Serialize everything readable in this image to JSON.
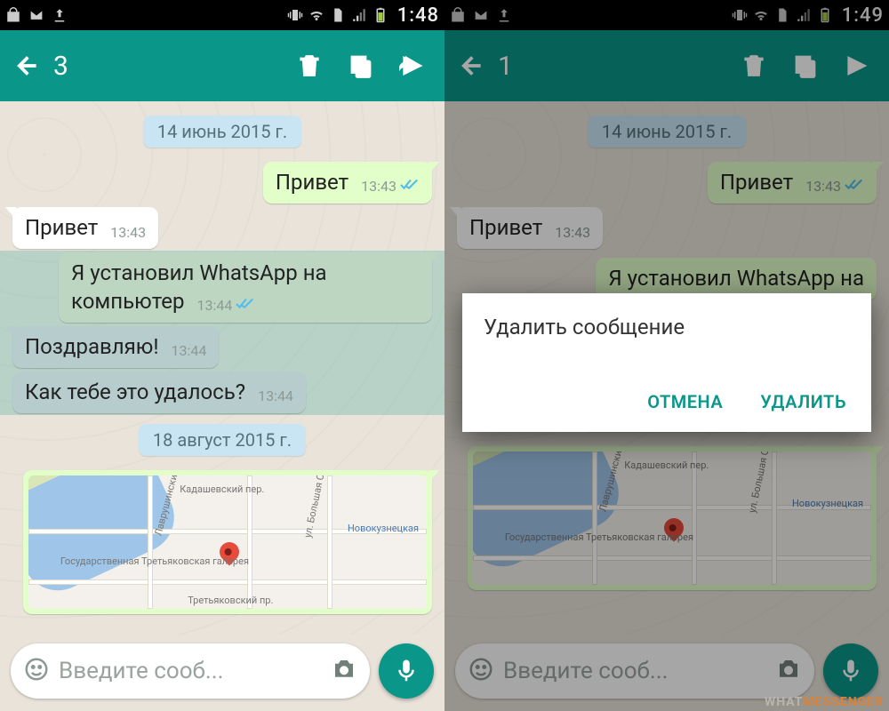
{
  "colors": {
    "teal": "#0a9688",
    "tick_read": "#53bdeb"
  },
  "left": {
    "status": {
      "clock": "1:48"
    },
    "selection_count": "3",
    "dates": {
      "d1": "14 июнь 2015 г.",
      "d2": "18 август 2015 г."
    },
    "messages": {
      "m1": {
        "text": "Привет",
        "time": "13:43"
      },
      "m2": {
        "text": "Привет",
        "time": "13:43"
      },
      "m3": {
        "text": "Я установил WhatsApp на компьютер",
        "time": "13:44"
      },
      "m4": {
        "text": "Поздравляю!",
        "time": "13:44"
      },
      "m5": {
        "text": "Как тебе это удалось?",
        "time": "13:44"
      }
    },
    "map_labels": {
      "a": "Лаврушинский пер.",
      "b": "Кадашевский пер.",
      "c": "ул. Большая Ордынка",
      "d": "Новокузнецкая",
      "e": "Государственная Третьяковская галерея",
      "f": "Третьяковский пр."
    },
    "input_placeholder": "Введите сооб..."
  },
  "right": {
    "status": {
      "clock": "1:49"
    },
    "selection_count": "1",
    "dates": {
      "d1": "14 июнь 2015 г.",
      "d2": "18 август 2015 г."
    },
    "messages": {
      "m1": {
        "text": "Привет",
        "time": "13:43"
      },
      "m2": {
        "text": "Привет",
        "time": "13:43"
      },
      "m3": {
        "text": "Я установил WhatsApp на",
        "time": ""
      }
    },
    "dialog": {
      "title": "Удалить сообщение",
      "cancel": "ОТМЕНА",
      "delete": "УДАЛИТЬ"
    },
    "map_labels": {
      "a": "Лаврушинский пер.",
      "b": "Кадашевский пер.",
      "c": "ул. Большая Ордынка",
      "d": "Новокузнецкая",
      "e": "Государственная Третьяковская галерея"
    },
    "input_placeholder": "Введите сооб...",
    "watermark": {
      "a": "WHAT",
      "b": "MESSENGER"
    }
  }
}
